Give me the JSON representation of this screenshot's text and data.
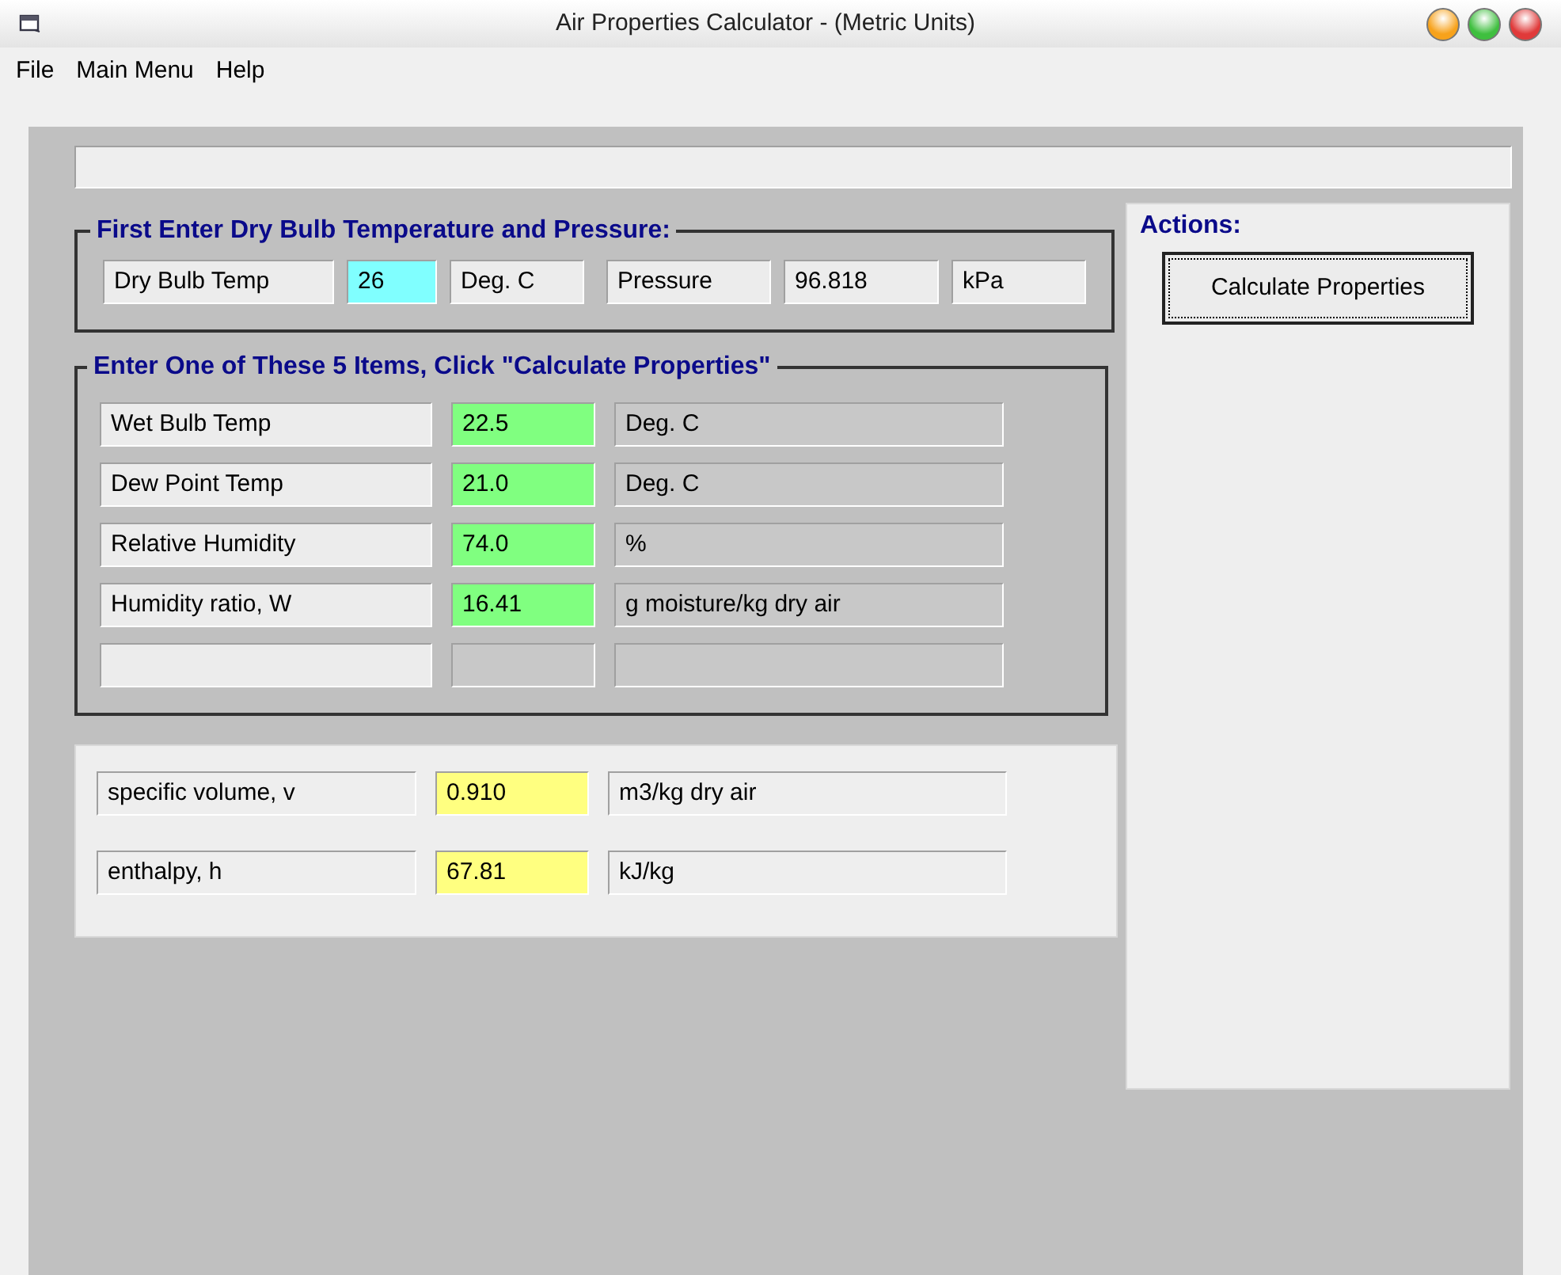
{
  "window": {
    "title": "Air Properties Calculator - (Metric Units)"
  },
  "menu": [
    "File",
    "Main Menu",
    "Help"
  ],
  "input_group": {
    "title": "First Enter Dry Bulb Temperature and Pressure:",
    "fields": [
      {
        "label": "Dry Bulb Temp",
        "value": "26",
        "unit": "Deg. C",
        "editable": true
      },
      {
        "label": "Pressure",
        "value": "96.818",
        "unit": "kPa",
        "editable": false
      }
    ]
  },
  "entry_group": {
    "title": "Enter One of These 5 Items, Click \"Calculate Properties\"",
    "rows": [
      {
        "kind": "filled",
        "label": "Wet Bulb Temp",
        "value": "22.5",
        "unit": "Deg. C"
      },
      {
        "kind": "filled",
        "label": "Dew Point Temp",
        "value": "21.0",
        "unit": "Deg. C"
      },
      {
        "kind": "filled",
        "label": "Relative Humidity",
        "value": "74.0",
        "unit": "%"
      },
      {
        "kind": "filled",
        "label": "Humidity ratio, W",
        "value": "16.41",
        "unit": "g moisture/kg dry air"
      },
      {
        "kind": "blank"
      }
    ]
  },
  "results": [
    {
      "label": "specific volume, v",
      "value": "0.910",
      "unit": "m3/kg dry air"
    },
    {
      "label": "enthalpy, h",
      "value": "67.81",
      "unit": "kJ/kg"
    }
  ],
  "actions": {
    "title": "Actions:",
    "button": {
      "label": "Calculate Properties",
      "focused": true
    }
  }
}
